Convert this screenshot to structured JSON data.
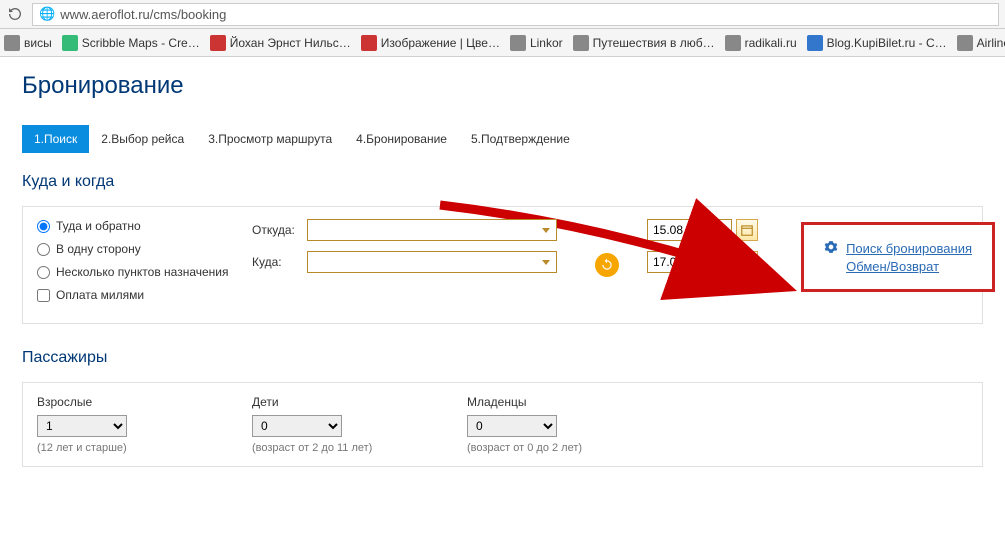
{
  "browser": {
    "url": "www.aeroflot.ru/cms/booking"
  },
  "bookmarks": [
    {
      "label": "висы",
      "color": "#888"
    },
    {
      "label": "Scribble Maps - Cre…",
      "color": "#3b7"
    },
    {
      "label": "Йохан Эрнст Нильс…",
      "color": "#c33"
    },
    {
      "label": "Изображение | Цве…",
      "color": "#c33"
    },
    {
      "label": "Linkor",
      "color": "#888"
    },
    {
      "label": "Путешествия в люб…",
      "color": "#888"
    },
    {
      "label": "radikali.ru",
      "color": "#888"
    },
    {
      "label": "Blog.KupiBilet.ru - С…",
      "color": "#37c"
    },
    {
      "label": "Airline",
      "color": "#888"
    }
  ],
  "page": {
    "title": "Бронирование",
    "steps": [
      "1.Поиск",
      "2.Выбор рейса",
      "3.Просмотр маршрута",
      "4.Бронирование",
      "5.Подтверждение"
    ],
    "section_where": "Куда и когда",
    "section_pax": "Пассажиры"
  },
  "callout": {
    "link1": "Поиск бронирования",
    "link2": "Обмен/Возврат"
  },
  "trip": {
    "roundtrip": "Туда и обратно",
    "oneway": "В одну сторону",
    "multi": "Несколько пунктов назначения",
    "miles": "Оплата милями",
    "from_label": "Откуда:",
    "to_label": "Куда:",
    "date1": "15.08.2015",
    "date2": "17.08.2015"
  },
  "pax": {
    "adults": {
      "label": "Взрослые",
      "value": "1",
      "hint": "(12 лет и старше)"
    },
    "children": {
      "label": "Дети",
      "value": "0",
      "hint": "(возраст от 2 до 11 лет)"
    },
    "infants": {
      "label": "Младенцы",
      "value": "0",
      "hint": "(возраст от 0 до 2 лет)"
    }
  }
}
